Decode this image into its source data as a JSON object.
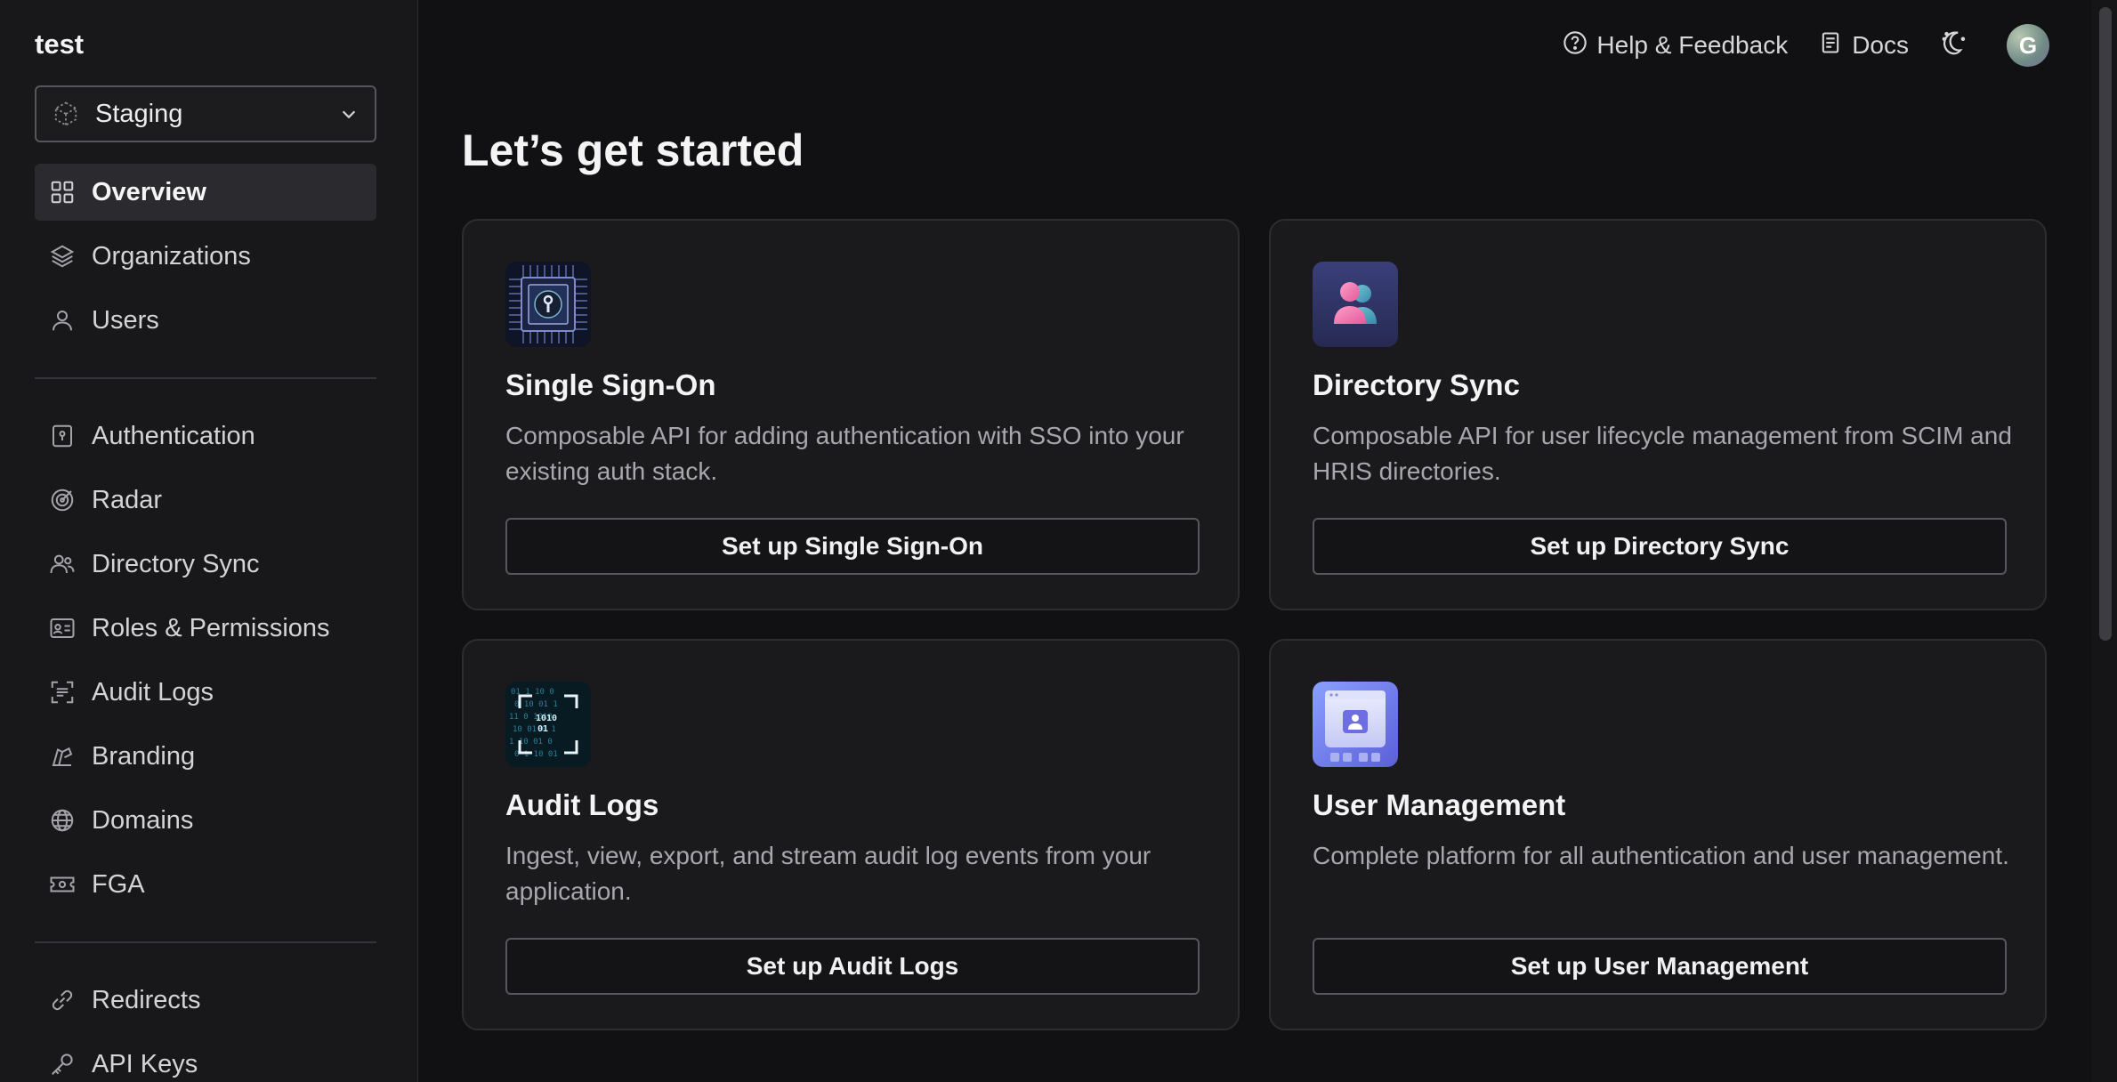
{
  "workspace": "test",
  "environment": {
    "selected": "Staging"
  },
  "sidebar": {
    "primary": [
      {
        "label": "Overview",
        "icon": "grid-icon"
      },
      {
        "label": "Organizations",
        "icon": "layers-icon"
      },
      {
        "label": "Users",
        "icon": "user-icon"
      }
    ],
    "products": [
      {
        "label": "Authentication",
        "icon": "keyhole-icon"
      },
      {
        "label": "Radar",
        "icon": "radar-icon"
      },
      {
        "label": "Directory Sync",
        "icon": "users-icon"
      },
      {
        "label": "Roles & Permissions",
        "icon": "id-card-icon"
      },
      {
        "label": "Audit Logs",
        "icon": "scan-icon"
      },
      {
        "label": "Branding",
        "icon": "brush-icon"
      },
      {
        "label": "Domains",
        "icon": "globe-icon"
      },
      {
        "label": "FGA",
        "icon": "ticket-icon"
      }
    ],
    "settings": [
      {
        "label": "Redirects",
        "icon": "link-icon"
      },
      {
        "label": "API Keys",
        "icon": "key-icon"
      }
    ]
  },
  "header": {
    "help": "Help & Feedback",
    "docs": "Docs",
    "avatar_initial": "G"
  },
  "main": {
    "title": "Let’s get started",
    "cards": [
      {
        "title": "Single Sign-On",
        "desc": "Composable API for adding authentication with SSO into your existing auth stack.",
        "button": "Set up Single Sign-On"
      },
      {
        "title": "Directory Sync",
        "desc": "Composable API for user lifecycle management from SCIM and HRIS directories.",
        "button": "Set up Directory Sync"
      },
      {
        "title": "Audit Logs",
        "desc": "Ingest, view, export, and stream audit log events from your application.",
        "button": "Set up Audit Logs"
      },
      {
        "title": "User Management",
        "desc": "Complete platform for all authentication and user management.",
        "button": "Set up User Management"
      }
    ]
  },
  "colors": {
    "background": "#111113",
    "sidebar": "#18181a",
    "card": "#1a1a1d",
    "active_nav": "#2b2b2f"
  }
}
